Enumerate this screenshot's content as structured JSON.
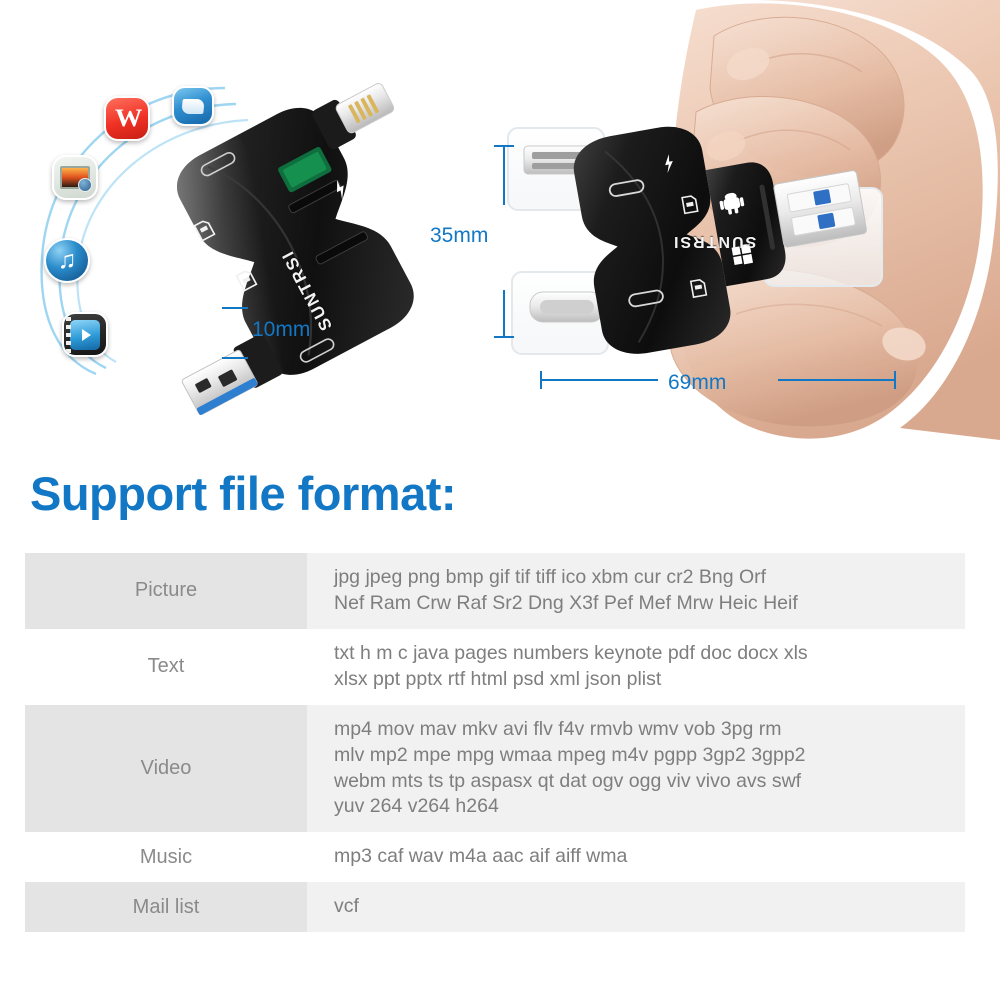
{
  "heading": "Support file format:",
  "product": {
    "brand": "SUNTRSI",
    "left_device_glyphs": [
      "sd-card-icon",
      "micro-sd-icon",
      "android-icon",
      "windows-icon",
      "lightning-bolt-icon",
      "usb-c-icon"
    ],
    "right_device_glyphs": [
      "lightning-bolt-icon",
      "micro-sd-icon",
      "android-icon",
      "windows-icon",
      "sd-card-icon",
      "usb-c-icon"
    ]
  },
  "dimensions": {
    "height": "35mm",
    "length": "69mm",
    "thickness": "10mm"
  },
  "app_icons": [
    {
      "name": "reader-app-icon",
      "label": ""
    },
    {
      "name": "wps-office-icon",
      "label": "W"
    },
    {
      "name": "photo-app-icon",
      "label": ""
    },
    {
      "name": "itunes-music-icon",
      "label": "♫"
    },
    {
      "name": "video-player-icon",
      "label": ""
    }
  ],
  "colors": {
    "accent_blue": "#1277c4",
    "heading_blue": "#1277c4",
    "row_shade": "#e4e4e4",
    "value_shade": "#f1f1f1",
    "text_gray": "#7e7e7e"
  },
  "format_table": {
    "rows": [
      {
        "category": "Picture",
        "lines": [
          "jpg  jpeg  png  bmp  gif  tif  tiff  ico  xbm  cur  cr2  Bng  Orf",
          "Nef  Ram  Crw  Raf  Sr2  Dng  X3f  Pef  Mef  Mrw  Heic  Heif"
        ]
      },
      {
        "category": "Text",
        "lines": [
          "txt  h  m  c  java  pages  numbers  keynote  pdf  doc  docx  xls",
          "xlsx  ppt  pptx  rtf  html  psd  xml  json  plist"
        ]
      },
      {
        "category": "Video",
        "lines": [
          "mp4  mov  mav  mkv  avi  flv  f4v  rmvb  wmv  vob  3pg  rm",
          "mlv  mp2  mpe  mpg  wmaa  mpeg  m4v   pgpp  3gp2  3gpp2",
          "webm  mts  ts  tp  aspasx  qt  dat  ogv  ogg  viv  vivo  avs  swf",
          "yuv 264  v264  h264"
        ]
      },
      {
        "category": "Music",
        "lines": [
          "mp3  caf  wav  m4a  aac  aif  aiff  wma"
        ]
      },
      {
        "category": "Mail list",
        "lines": [
          "vcf"
        ]
      }
    ]
  }
}
